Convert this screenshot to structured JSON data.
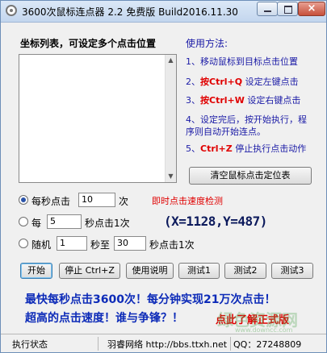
{
  "window": {
    "title": "3600次鼠标连点器 2.2 免费版  Build2016.11.30",
    "close_glyph": "×"
  },
  "list": {
    "heading": "坐标列表，可设定多个点击位置",
    "items": []
  },
  "help": {
    "title": "使用方法:",
    "step1": "1、移动鼠标到目标点击位置",
    "step2_num": "2、",
    "step2_key": "按Ctrl+Q",
    "step2_text": " 设定左键点击",
    "step3_num": "3、",
    "step3_key": "按Ctrl+W",
    "step3_text": " 设定右键点击",
    "step4_line1": "4、设定完后，按开始执行，程",
    "step4_line2": "序则自动开始连点。",
    "step5_num": "5、",
    "step5_key": "Ctrl+Z",
    "step5_text": " 停止执行点击动作"
  },
  "buttons": {
    "clear_positions": "清空鼠标点击定位表",
    "start": "开始",
    "stop": "停止 Ctrl+Z",
    "instructions": "使用说明",
    "test1": "测试1",
    "test2": "测试2",
    "test3": "测试3"
  },
  "mode_per_second": {
    "label": "每秒点击",
    "value": "10",
    "unit": "次",
    "selected": true
  },
  "speed_check_link": "即时点击速度检测",
  "mode_every_seconds": {
    "prefix": "每",
    "value": "5",
    "suffix": "秒点击1次",
    "selected": false
  },
  "mode_random": {
    "prefix": "随机",
    "from": "1",
    "mid": "秒至",
    "to": "30",
    "suffix": "秒点击1次",
    "selected": false
  },
  "coordinates": "(X=1128,Y=487)",
  "promo": {
    "line1": "最快每秒点击3600次！每分钟实现21万次点击！",
    "line2": "超高的点击速度！谁与争锋？！",
    "link": "点此了解正式版"
  },
  "statusbar": {
    "status": "执行状态",
    "site": "羽睿网络 http://bbs.ttxh.net",
    "qq": "QQ：27248809"
  },
  "watermark": {
    "text": "绿色资源网",
    "url": "www.downcc.com"
  },
  "colors": {
    "help_blue": "#1a1aa6",
    "accent_red": "#e00000",
    "promo_blue": "#0d2bb8"
  },
  "icons": {
    "app": "mouse-cursor-icon"
  }
}
